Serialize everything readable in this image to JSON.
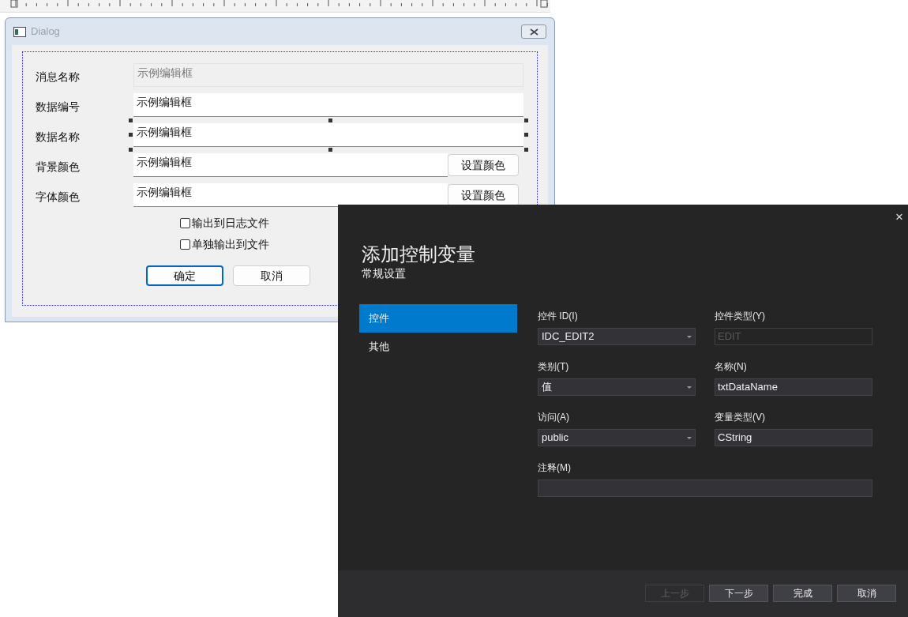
{
  "designer": {
    "window": {
      "title": "Dialog"
    },
    "rows": [
      {
        "label": "消息名称",
        "value": "示例编辑框",
        "disabled": true,
        "selected": false
      },
      {
        "label": "数据编号",
        "value": "示例编辑框",
        "disabled": false,
        "selected": false
      },
      {
        "label": "数据名称",
        "value": "示例编辑框",
        "disabled": false,
        "selected": true
      },
      {
        "label": "背景颜色",
        "value": "示例编辑框",
        "disabled": false,
        "selected": false,
        "button": "设置颜色"
      },
      {
        "label": "字体颜色",
        "value": "示例编辑框",
        "disabled": false,
        "selected": false,
        "button": "设置颜色"
      }
    ],
    "checkboxes": [
      {
        "label": "输出到日志文件",
        "checked": false
      },
      {
        "label": "单独输出到文件",
        "checked": false
      }
    ],
    "buttons": [
      {
        "label": "确定",
        "default": true
      },
      {
        "label": "取消",
        "default": false
      }
    ]
  },
  "wizard": {
    "close": "×",
    "title": "添加控制变量",
    "subtitle": "常规设置",
    "nav": [
      {
        "label": "控件",
        "selected": true
      },
      {
        "label": "其他",
        "selected": false
      }
    ],
    "fields": [
      {
        "label": "控件 ID(I)",
        "kind": "dropdown",
        "value": "IDC_EDIT2",
        "disabled": false
      },
      {
        "label": "控件类型(Y)",
        "kind": "text",
        "value": "EDIT",
        "disabled": true
      },
      {
        "label": "类别(T)",
        "kind": "dropdown",
        "value": "值",
        "disabled": false
      },
      {
        "label": "名称(N)",
        "kind": "text",
        "value": "txtDataName",
        "disabled": false
      },
      {
        "label": "访问(A)",
        "kind": "dropdown",
        "value": "public",
        "disabled": false
      },
      {
        "label": "变量类型(V)",
        "kind": "text",
        "value": "CString",
        "disabled": false
      }
    ],
    "comment": {
      "label": "注释(M)"
    },
    "buttons": [
      {
        "label": "上一步",
        "disabled": true
      },
      {
        "label": "下一步",
        "disabled": false
      },
      {
        "label": "完成",
        "disabled": false
      },
      {
        "label": "取消",
        "disabled": false
      }
    ]
  }
}
